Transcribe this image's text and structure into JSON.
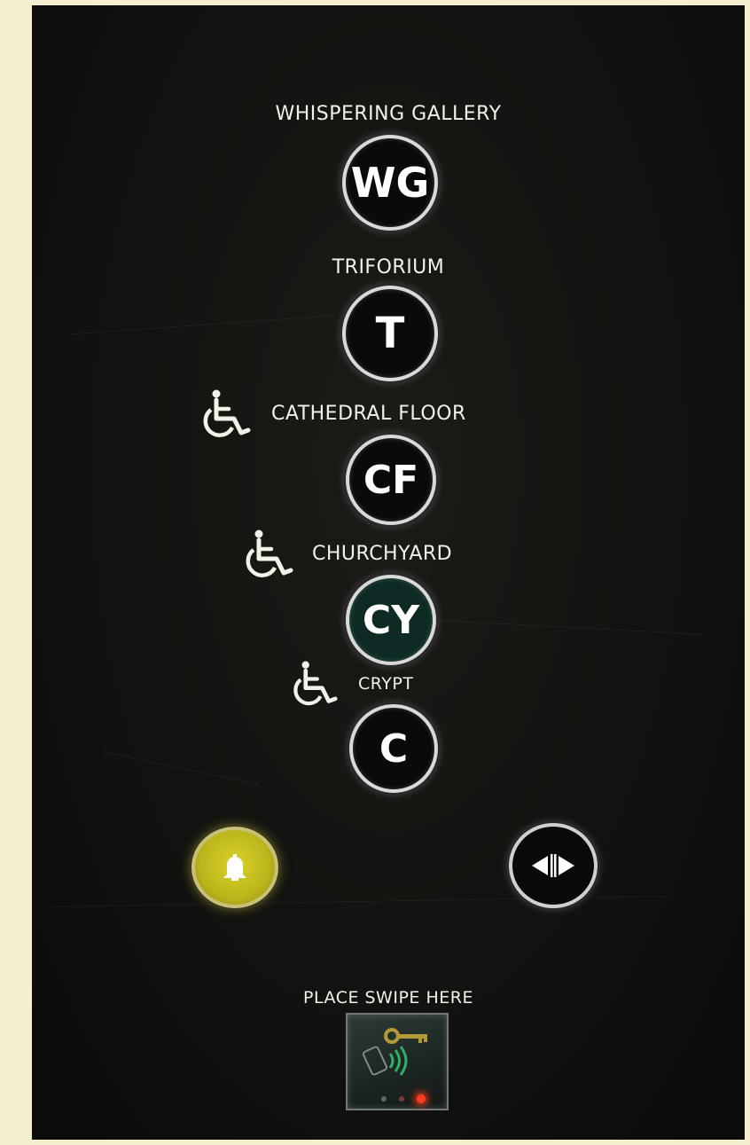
{
  "floors": [
    {
      "name": "WHISPERING GALLERY",
      "code": "WG",
      "accessible": false
    },
    {
      "name": "TRIFORIUM",
      "code": "T",
      "accessible": false
    },
    {
      "name": "CATHEDRAL FLOOR",
      "code": "CF",
      "accessible": true
    },
    {
      "name": "CHURCHYARD",
      "code": "CY",
      "accessible": true,
      "lit": true
    },
    {
      "name": "CRYPT",
      "code": "C",
      "accessible": true
    }
  ],
  "controls": {
    "alarm_icon": "bell-icon",
    "door_icon": "door-open-icon"
  },
  "swipe": {
    "label": "PLACE SWIPE HERE",
    "card_icon": "key-card-icon",
    "indicator_color": "#ff3b1f"
  },
  "colors": {
    "panel": "#121210",
    "frame": "#f6efcf",
    "text": "#f4f1e6",
    "alarm": "#cfc823",
    "lit_button": "#0d2b24"
  }
}
